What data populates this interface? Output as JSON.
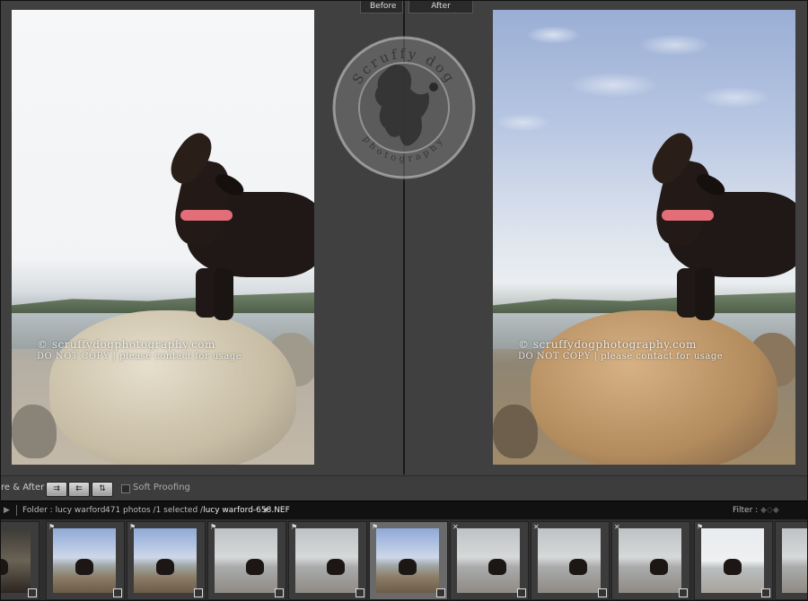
{
  "compare": {
    "before_label": "Before",
    "after_label": "After",
    "watermark_line1": "© scruffydogphotography.com",
    "watermark_line2": "DO NOT COPY | please contact for usage"
  },
  "logo": {
    "top_text": "Scruffy dog",
    "bottom_text": "photography"
  },
  "toolbar": {
    "view_label": "re & After :",
    "soft_proofing_label": "Soft Proofing",
    "soft_proofing_checked": false
  },
  "filmstrip_header": {
    "folder_label": "Folder : lucy warford",
    "count_label": "471 photos /1 selected /",
    "selected_file": "lucy warford-658.NEF",
    "filter_label": "Filter :"
  },
  "colors": {
    "panel_bg": "#404040",
    "toolbar_bg": "#3e3d3e",
    "filmstrip_header_bg": "#111111",
    "collar_pink": "#e46e77"
  },
  "filmstrip": {
    "thumbnails": [
      {
        "style": "dark",
        "flag": "",
        "selected": false
      },
      {
        "style": "blue",
        "flag": "⚑",
        "selected": false
      },
      {
        "style": "blue",
        "flag": "⚑",
        "selected": false
      },
      {
        "style": "grey",
        "flag": "⚑",
        "selected": false
      },
      {
        "style": "grey",
        "flag": "⚑",
        "selected": false
      },
      {
        "style": "blue",
        "flag": "⚑",
        "selected": true
      },
      {
        "style": "grey",
        "flag": "✕",
        "selected": false
      },
      {
        "style": "grey",
        "flag": "✕",
        "selected": false
      },
      {
        "style": "grey",
        "flag": "✕",
        "selected": false
      },
      {
        "style": "pale",
        "flag": "⚑",
        "selected": false
      },
      {
        "style": "grey",
        "flag": "",
        "selected": false
      }
    ]
  }
}
